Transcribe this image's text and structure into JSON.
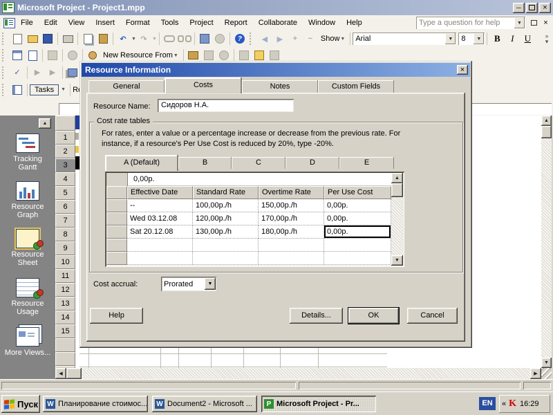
{
  "colors": {
    "titlebar": "#8393b6",
    "dialog_titlebar": "#2049a8",
    "toolbar_bg": "#f3f1e9",
    "dialog_bg": "#d6d2c8",
    "viewbar_bg": "#848484",
    "selected_row": "#8f8f8f",
    "lang_badge": "#2a4f9e"
  },
  "icons": {
    "close": "×",
    "minimize": "─",
    "scroll_up": "▲",
    "scroll_down": "▼",
    "scroll_left": "◀",
    "scroll_right": "▶",
    "dropdown": "▼",
    "undo": "↶",
    "redo": "↷",
    "help": "?",
    "back": "◀",
    "forward": "▶",
    "plus": "+",
    "minus": "−",
    "overflow": "»",
    "tray_chevron": "«",
    "check": "✓"
  },
  "titlebar": {
    "title": "Microsoft Project - Project1.mpp"
  },
  "menubar": {
    "items": [
      "File",
      "Edit",
      "View",
      "Insert",
      "Format",
      "Tools",
      "Project",
      "Report",
      "Collaborate",
      "Window",
      "Help"
    ],
    "help_placeholder": "Type a question for help"
  },
  "toolbars": {
    "show": "Show",
    "font": "Arial",
    "size": "8",
    "bold": "B",
    "italic": "I",
    "underline": "U",
    "new_resource_from": "New Resource From",
    "tasks": "Tasks",
    "resources": "Res"
  },
  "viewbar": {
    "items": [
      "Tracking Gantt",
      "Resource Graph",
      "Resource Sheet",
      "Resource Usage",
      "More Views..."
    ],
    "selected": "Resource Sheet"
  },
  "sheet": {
    "row_numbers": [
      "1",
      "2",
      "3",
      "4",
      "5",
      "6",
      "7",
      "8",
      "9",
      "10",
      "11",
      "12",
      "13",
      "14",
      "15"
    ],
    "selected_row": "3"
  },
  "dialog": {
    "title": "Resource Information",
    "tabs": [
      "General",
      "Costs",
      "Notes",
      "Custom Fields"
    ],
    "active_tab": "Costs",
    "resource_name_label": "Resource Name:",
    "resource_name_value": "Сидоров Н.А.",
    "group_label": "Cost rate tables",
    "description_line1": "For rates, enter a value or a percentage increase or decrease from the previous rate. For",
    "description_line2": "instance, if a resource's Per Use Cost is reduced by 20%, type -20%.",
    "rate_tabs": [
      "A (Default)",
      "B",
      "C",
      "D",
      "E"
    ],
    "active_rate_tab": "A (Default)",
    "edit_value": "0,00р.",
    "grid": {
      "headers": [
        "Effective Date",
        "Standard Rate",
        "Overtime Rate",
        "Per Use Cost"
      ],
      "rows": [
        [
          "--",
          "100,00р./h",
          "150,00р./h",
          "0,00р."
        ],
        [
          "Wed 03.12.08",
          "120,00р./h",
          "170,00р./h",
          "0,00р."
        ],
        [
          "Sat 20.12.08",
          "130,00р./h",
          "180,00р./h",
          "0,00р."
        ]
      ],
      "selected_cell": {
        "row": 2,
        "col": 3,
        "value": "0,00р."
      }
    },
    "cost_accrual_label": "Cost accrual:",
    "cost_accrual_value": "Prorated",
    "buttons": {
      "help": "Help",
      "details": "Details...",
      "ok": "OK",
      "cancel": "Cancel"
    }
  },
  "taskbar": {
    "start": "Пуск",
    "buttons": [
      "Планирование стоимос...",
      "Document2 - Microsoft ...",
      "Microsoft Project - Pr..."
    ],
    "active_button": "Microsoft Project - Pr...",
    "lang": "EN",
    "time": "16:29"
  }
}
